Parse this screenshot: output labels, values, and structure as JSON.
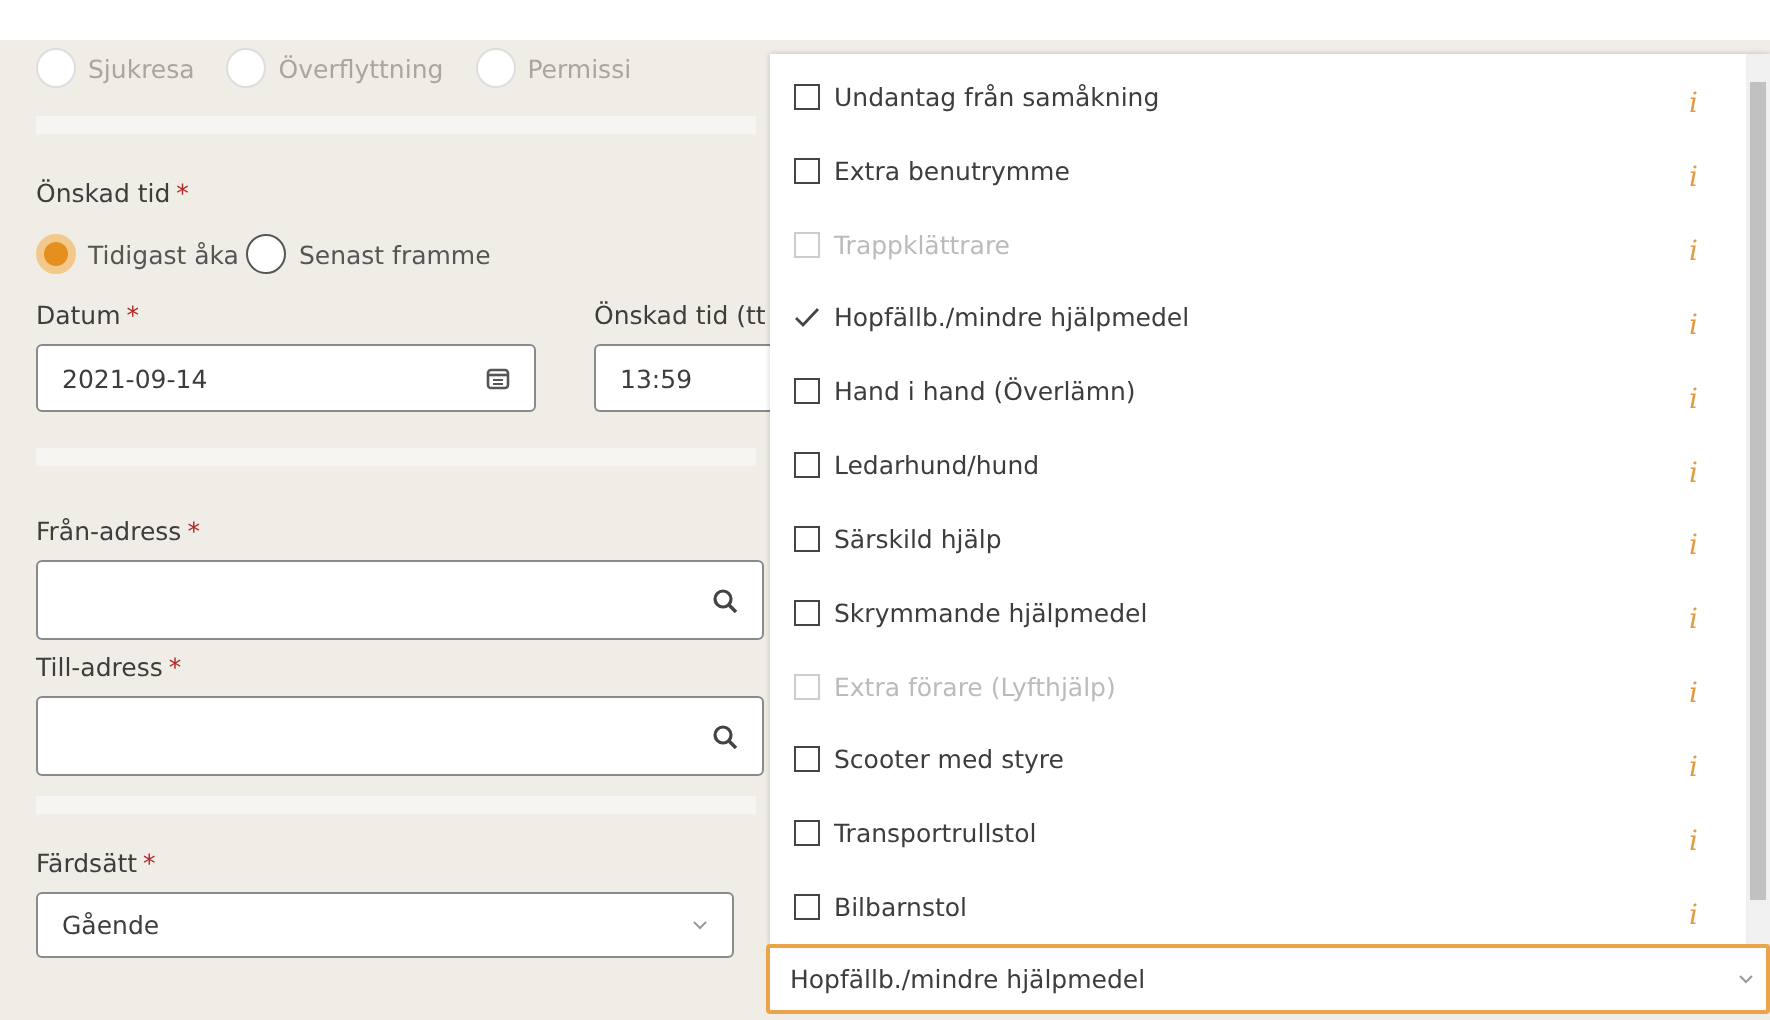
{
  "trip_types": [
    {
      "label": "Sjukresa",
      "selected": false
    },
    {
      "label": "Överflyttning",
      "selected": false
    },
    {
      "label": "Permissi",
      "selected": false
    }
  ],
  "desired_time": {
    "label": "Önskad tid",
    "marker": "*",
    "options": [
      {
        "label": "Tidigast åka",
        "selected": true
      },
      {
        "label": "Senast framme",
        "selected": false
      }
    ]
  },
  "date": {
    "label": "Datum",
    "marker": "*",
    "value": "2021-09-14"
  },
  "time": {
    "label": "Önskad tid (tt",
    "value": "13:59"
  },
  "from_address": {
    "label": "Från-adress",
    "marker": "*"
  },
  "to_address": {
    "label": "Till-adress",
    "marker": "*"
  },
  "travel_mode": {
    "label": "Färdsätt",
    "marker": "*",
    "value": "Gående"
  },
  "aids": {
    "value": "Hopfällb./mindre hjälpmedel",
    "options": [
      {
        "label": "Undantag från samåkning",
        "checked": false,
        "disabled": false,
        "info": "i"
      },
      {
        "label": "Extra benutrymme",
        "checked": false,
        "disabled": false,
        "info": "i"
      },
      {
        "label": "Trappklättrare",
        "checked": false,
        "disabled": true,
        "info": "i"
      },
      {
        "label": "Hopfällb./mindre hjälpmedel",
        "checked": true,
        "disabled": false,
        "info": "i"
      },
      {
        "label": "Hand i hand (Överlämn)",
        "checked": false,
        "disabled": false,
        "info": "i"
      },
      {
        "label": "Ledarhund/hund",
        "checked": false,
        "disabled": false,
        "info": "i"
      },
      {
        "label": "Särskild hjälp",
        "checked": false,
        "disabled": false,
        "info": "i"
      },
      {
        "label": "Skrymmande hjälpmedel",
        "checked": false,
        "disabled": false,
        "info": "i"
      },
      {
        "label": "Extra förare (Lyfthjälp)",
        "checked": false,
        "disabled": true,
        "info": "i"
      },
      {
        "label": "Scooter med styre",
        "checked": false,
        "disabled": false,
        "info": "i"
      },
      {
        "label": "Transportrullstol",
        "checked": false,
        "disabled": false,
        "info": "i"
      },
      {
        "label": "Bilbarnstol",
        "checked": false,
        "disabled": false,
        "info": "i"
      }
    ]
  }
}
